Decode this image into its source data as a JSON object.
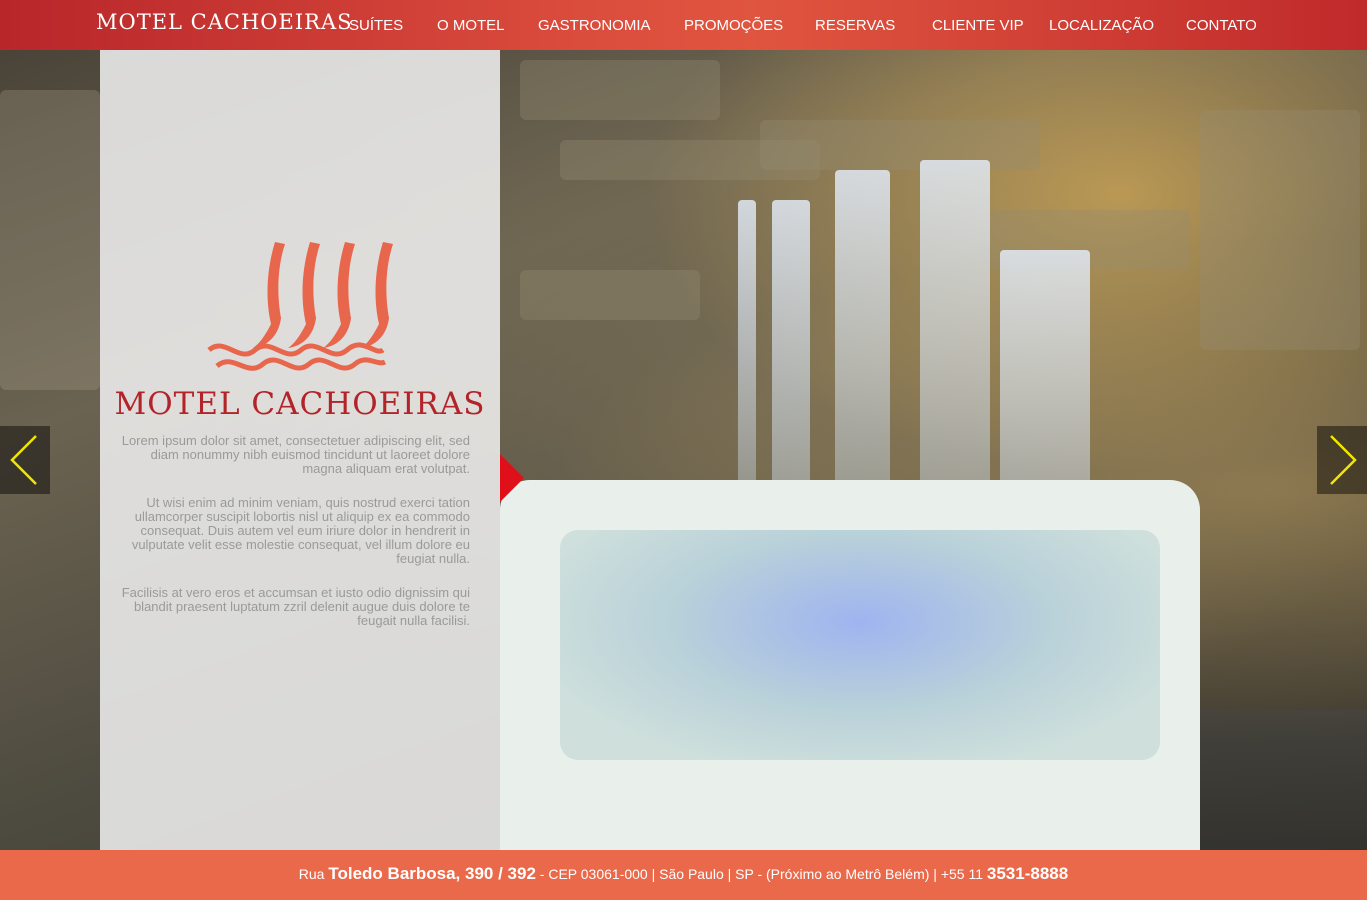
{
  "header": {
    "brand": "MOTEL CACHOEIRAS",
    "nav": [
      {
        "label": "SUÍTES"
      },
      {
        "label": "O MOTEL"
      },
      {
        "label": "GASTRONOMIA"
      },
      {
        "label": "PROMOÇÕES"
      },
      {
        "label": "RESERVAS"
      },
      {
        "label": "CLIENTE VIP"
      },
      {
        "label": "LOCALIZAÇÃO"
      },
      {
        "label": "CONTATO"
      }
    ]
  },
  "hero": {
    "logo_text": "MOTEL CACHOEIRAS",
    "paragraphs": [
      "Lorem ipsum dolor sit amet, consectetuer adipiscing elit, sed diam nonummy nibh euismod tincidunt ut laoreet dolore magna aliquam erat volutpat.",
      "Ut wisi enim ad minim veniam, quis nostrud exerci tation ullamcorper suscipit lobortis nisl ut aliquip ex ea commodo consequat. Duis autem vel eum iriure dolor in hendrerit in vulputate velit esse molestie consequat, vel illum dolore eu feugiat nulla.",
      "Facilisis at vero eros et accumsan et iusto odio dignissim qui blandit praesent luptatum zzril delenit augue duis dolore te feugait nulla facilisi."
    ],
    "prev_icon": "chevron-left-icon",
    "next_icon": "chevron-right-icon"
  },
  "footer": {
    "street_prefix": "Rua",
    "street_name": "Toledo Barbosa, 390 / 392",
    "details": " - CEP 03061-000 | São Paulo | SP - (Próximo ao Metrô Belém) | +55 11 ",
    "phone": "3531-8888"
  },
  "colors": {
    "header_bg": "#c9342f",
    "accent": "#b3242a",
    "logo_orange": "#e8664c",
    "footer_bg": "#e9694a",
    "arrow_yellow": "#f2e600",
    "marker_red": "#e0101b"
  }
}
